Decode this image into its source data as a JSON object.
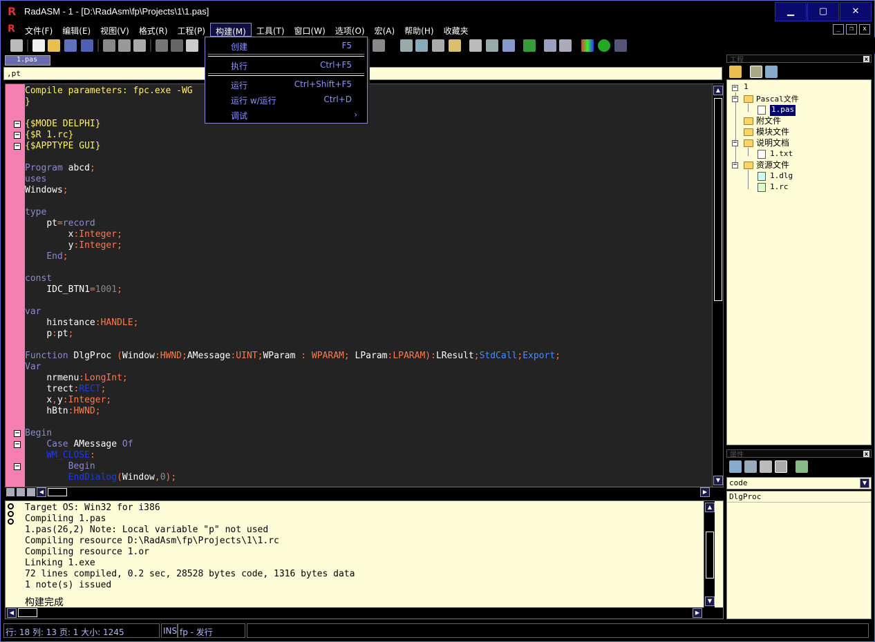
{
  "window": {
    "title": "RadASM - 1 - [D:\\RadAsm\\fp\\Projects\\1\\1.pas]",
    "minimize": "▁",
    "maximize": "▢",
    "close": "✕"
  },
  "menubar": {
    "items": [
      "文件(F)",
      "编辑(E)",
      "视图(V)",
      "格式(R)",
      "工程(P)",
      "构建(M)",
      "工具(T)",
      "窗口(W)",
      "选项(O)",
      "宏(A)",
      "帮助(H)",
      "收藏夹"
    ],
    "active_index": 5,
    "mdi_min": "_",
    "mdi_restore": "❐",
    "mdi_close": "x"
  },
  "build_menu": {
    "items": [
      {
        "label": "创建",
        "shortcut": "F5"
      },
      {
        "label": "执行",
        "shortcut": "Ctrl+F5"
      },
      {
        "label": "运行",
        "shortcut": "Ctrl+Shift+F5"
      },
      {
        "label": "运行 w/运行",
        "shortcut": "Ctrl+D"
      },
      {
        "label": "调试",
        "shortcut": "›"
      }
    ]
  },
  "editor": {
    "tab_label": "1.pas",
    "info_text": ",pt",
    "lines": [
      [
        [
          "Compile parameters: fpc.exe -WG ",
          "y"
        ]
      ],
      [
        [
          "}",
          "y"
        ]
      ],
      [],
      [
        [
          "{$MODE DELPHI}",
          "y"
        ]
      ],
      [
        [
          "{$R 1.rc}",
          "y"
        ]
      ],
      [
        [
          "{$APPTYPE GUI}",
          "y"
        ]
      ],
      [],
      [
        [
          "Program ",
          "k"
        ],
        [
          "abcd",
          "w"
        ],
        [
          ";",
          "o"
        ]
      ],
      [
        [
          "uses",
          "k"
        ]
      ],
      [
        [
          "Windows",
          "w"
        ],
        [
          ";",
          "o"
        ]
      ],
      [],
      [
        [
          "type",
          "k"
        ]
      ],
      [
        [
          "    ",
          "w"
        ],
        [
          "pt",
          "w"
        ],
        [
          "=",
          "o"
        ],
        [
          "record",
          "k"
        ]
      ],
      [
        [
          "        ",
          "w"
        ],
        [
          "x",
          "w"
        ],
        [
          ":",
          "o"
        ],
        [
          "Integer",
          "o"
        ],
        [
          ";",
          "o"
        ]
      ],
      [
        [
          "        ",
          "w"
        ],
        [
          "y",
          "w"
        ],
        [
          ":",
          "o"
        ],
        [
          "Integer",
          "o"
        ],
        [
          ";",
          "o"
        ]
      ],
      [
        [
          "    ",
          "w"
        ],
        [
          "End",
          "k"
        ],
        [
          ";",
          "o"
        ]
      ],
      [],
      [
        [
          "const",
          "k"
        ]
      ],
      [
        [
          "    ",
          "w"
        ],
        [
          "IDC_BTN1",
          "w"
        ],
        [
          "=",
          "o"
        ],
        [
          "1001",
          "g"
        ],
        [
          ";",
          "o"
        ]
      ],
      [],
      [
        [
          "var",
          "k"
        ]
      ],
      [
        [
          "    ",
          "w"
        ],
        [
          "hinstance",
          "w"
        ],
        [
          ":",
          "o"
        ],
        [
          "HANDLE",
          "o"
        ],
        [
          ";",
          "o"
        ]
      ],
      [
        [
          "    ",
          "w"
        ],
        [
          "p",
          "w"
        ],
        [
          ":",
          "o"
        ],
        [
          "pt",
          "w"
        ],
        [
          ";",
          "o"
        ]
      ],
      [],
      [
        [
          "Function ",
          "k"
        ],
        [
          "DlgProc ",
          "w"
        ],
        [
          "(",
          "o"
        ],
        [
          "Window",
          "w"
        ],
        [
          ":",
          "o"
        ],
        [
          "HWND",
          "o"
        ],
        [
          ";",
          "o"
        ],
        [
          "AMessage",
          "w"
        ],
        [
          ":",
          "o"
        ],
        [
          "UINT",
          "o"
        ],
        [
          ";",
          "o"
        ],
        [
          "WParam ",
          "w"
        ],
        [
          ": ",
          "o"
        ],
        [
          "WPARAM",
          "o"
        ],
        [
          "; ",
          "o"
        ],
        [
          "LParam",
          "w"
        ],
        [
          ":",
          "o"
        ],
        [
          "LPARAM",
          "o"
        ],
        [
          "):",
          "o"
        ],
        [
          "LResult",
          "w"
        ],
        [
          ";",
          "o"
        ],
        [
          "StdCall",
          "b"
        ],
        [
          ";",
          "o"
        ],
        [
          "Export",
          "b"
        ],
        [
          ";",
          "o"
        ]
      ],
      [
        [
          "Var",
          "k"
        ]
      ],
      [
        [
          "    ",
          "w"
        ],
        [
          "nrmenu",
          "w"
        ],
        [
          ":",
          "o"
        ],
        [
          "LongInt",
          "o"
        ],
        [
          ";",
          "o"
        ]
      ],
      [
        [
          "    ",
          "w"
        ],
        [
          "trect",
          "w"
        ],
        [
          ":",
          "o"
        ],
        [
          "RECT",
          "hb"
        ],
        [
          ";",
          "o"
        ]
      ],
      [
        [
          "    ",
          "w"
        ],
        [
          "x",
          "w"
        ],
        [
          ",",
          "o"
        ],
        [
          "y",
          "w"
        ],
        [
          ":",
          "o"
        ],
        [
          "Integer",
          "o"
        ],
        [
          ";",
          "o"
        ]
      ],
      [
        [
          "    ",
          "w"
        ],
        [
          "hBtn",
          "w"
        ],
        [
          ":",
          "o"
        ],
        [
          "HWND",
          "o"
        ],
        [
          ";",
          "o"
        ]
      ],
      [],
      [
        [
          "Begin",
          "k"
        ]
      ],
      [
        [
          "    ",
          "w"
        ],
        [
          "Case ",
          "k"
        ],
        [
          "AMessage ",
          "w"
        ],
        [
          "Of",
          "k"
        ]
      ],
      [
        [
          "    ",
          "w"
        ],
        [
          "WM_CLOSE",
          "hb"
        ],
        [
          ":",
          "o"
        ]
      ],
      [
        [
          "        ",
          "w"
        ],
        [
          "Begin",
          "k"
        ]
      ],
      [
        [
          "        ",
          "w"
        ],
        [
          "EndDialog",
          "hb"
        ],
        [
          "(",
          "o"
        ],
        [
          "Window",
          "w"
        ],
        [
          ",",
          "o"
        ],
        [
          "0",
          "g"
        ],
        [
          ");",
          "o"
        ]
      ]
    ]
  },
  "output": {
    "lines": [
      "Target OS: Win32 for i386",
      "Compiling 1.pas",
      "1.pas(26,2) Note: Local variable \"p\" not used",
      "Compiling resource D:\\RadAsm\\fp\\Projects\\1\\1.rc",
      "Compiling resource 1.or",
      "Linking 1.exe",
      "72 lines compiled, 0.2 sec, 28528 bytes code, 1316 bytes data",
      "1 note(s) issued"
    ],
    "status_line": "构建完成"
  },
  "statusbar": {
    "position": "行: 18  列:  13 页: 1 大小: 1245",
    "mode": "INS",
    "build_type": "fp - 发行"
  },
  "project": {
    "header": "工程",
    "tree": {
      "root": "1",
      "pascal_group": "Pascal文件",
      "pascal_file": "1.pas",
      "misc_group": "附文件",
      "module_group": "模块文件",
      "docs_group": "说明文档",
      "docs_file": "1.txt",
      "res_group": "资源文件",
      "res_file_dlg": "1.dlg",
      "res_file_rc": "1.rc"
    }
  },
  "properties": {
    "header": "属性",
    "selected": "code",
    "items": [
      "DlgProc"
    ]
  },
  "colors": {
    "keyword": "#8a8ad0",
    "directive": "#fff06a",
    "symbol": "#ff7a4a",
    "gutter": "#f47fb0",
    "panel_bg": "#fffdd8"
  }
}
